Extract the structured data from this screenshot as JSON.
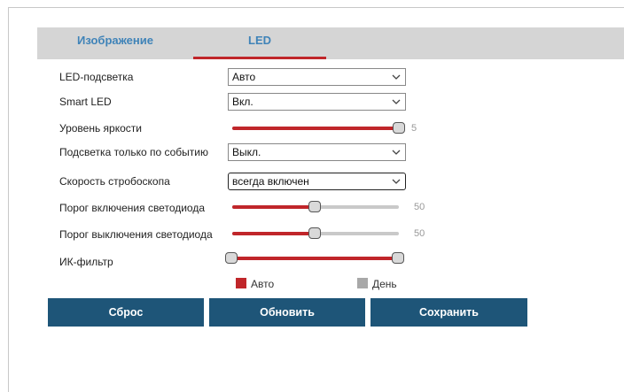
{
  "tabs": [
    {
      "label": "Изображение",
      "active": false
    },
    {
      "label": "LED",
      "active": true
    }
  ],
  "fields": {
    "led_backlight": {
      "label": "LED-подсветка",
      "value": "Авто"
    },
    "smart_led": {
      "label": "Smart LED",
      "value": "Вкл."
    },
    "brightness": {
      "label": "Уровень яркости",
      "value": "5",
      "level_fraction": 1.0
    },
    "event_only": {
      "label": "Подсветка только по событию",
      "value": "Выкл."
    },
    "strobe_speed": {
      "label": "Скорость стробоскопа",
      "value": "всегда включен"
    },
    "on_threshold": {
      "label": "Порог включения светодиода",
      "value": "50",
      "level_fraction": 0.5
    },
    "off_threshold": {
      "label": "Порог выключения светодиода",
      "value": "50",
      "level_fraction": 0.5
    },
    "ir_filter": {
      "label": "ИК-фильтр"
    }
  },
  "legend": {
    "auto_label": "Авто",
    "auto_color": "#c0262a",
    "day_label": "День",
    "day_color": "#a8a8a8"
  },
  "buttons": {
    "reset": "Сброс",
    "refresh": "Обновить",
    "save": "Сохранить"
  },
  "colors": {
    "accent": "#c0262a",
    "button": "#1e5578",
    "tab_text": "#3f83b8"
  }
}
